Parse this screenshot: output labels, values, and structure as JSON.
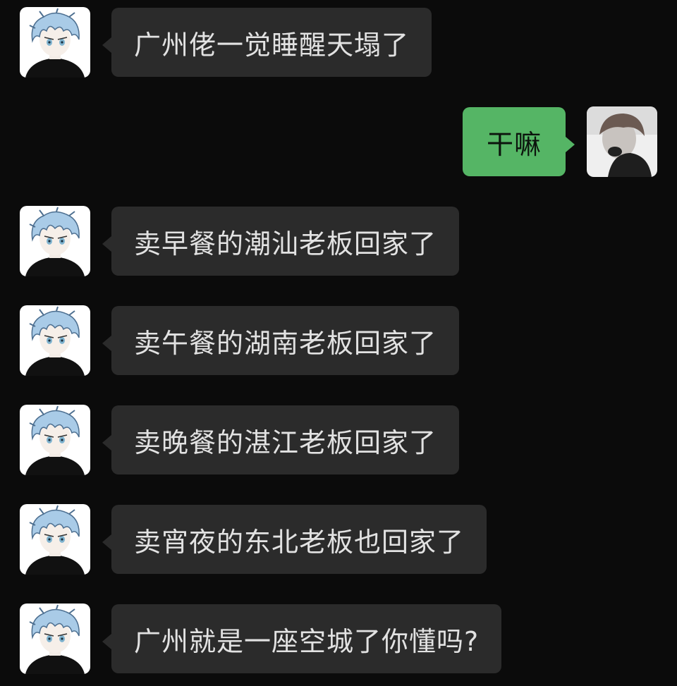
{
  "chat": {
    "messages": [
      {
        "side": "left",
        "avatar": "anime-boy-avatar",
        "text": "广州佬一觉睡醒天塌了"
      },
      {
        "side": "right",
        "avatar": "user-photo-avatar",
        "text": "干嘛"
      },
      {
        "side": "left",
        "avatar": "anime-boy-avatar",
        "text": "卖早餐的潮汕老板回家了"
      },
      {
        "side": "left",
        "avatar": "anime-boy-avatar",
        "text": "卖午餐的湖南老板回家了"
      },
      {
        "side": "left",
        "avatar": "anime-boy-avatar",
        "text": "卖晚餐的湛江老板回家了"
      },
      {
        "side": "left",
        "avatar": "anime-boy-avatar",
        "text": "卖宵夜的东北老板也回家了"
      },
      {
        "side": "left",
        "avatar": "anime-boy-avatar",
        "text": "广州就是一座空城了你懂吗?"
      }
    ]
  },
  "colors": {
    "background": "#0b0b0b",
    "incoming_bubble": "#2b2b2b",
    "outgoing_bubble": "#55b565",
    "incoming_text": "#e2e2e2"
  }
}
